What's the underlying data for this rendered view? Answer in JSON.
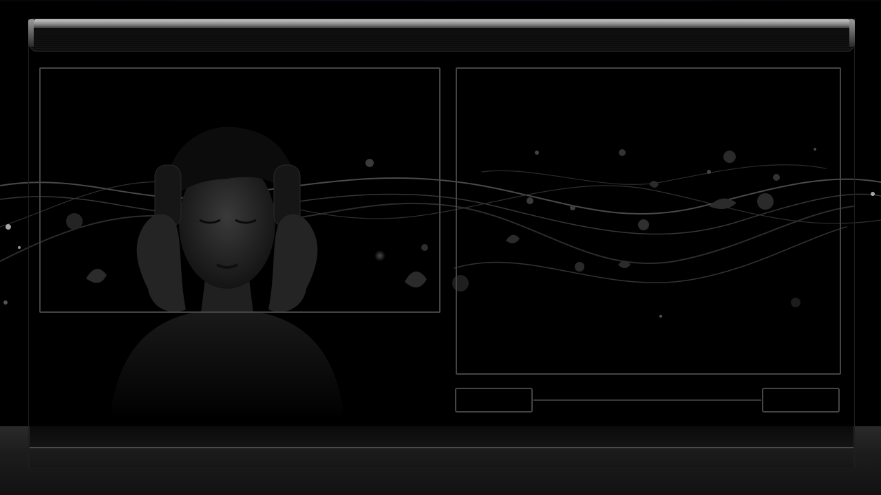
{
  "window": {
    "title": ""
  },
  "media": {
    "left_label": "",
    "right_label": ""
  },
  "navigation": {
    "prev_label": "",
    "next_label": "",
    "progress": 0
  },
  "colors": {
    "background": "#000000",
    "frame_border": "#454545",
    "title_shine": "#c8c8c8",
    "floor": "#2a2a2a"
  },
  "icons": {
    "figure": "woman-with-headphones-illustration"
  }
}
